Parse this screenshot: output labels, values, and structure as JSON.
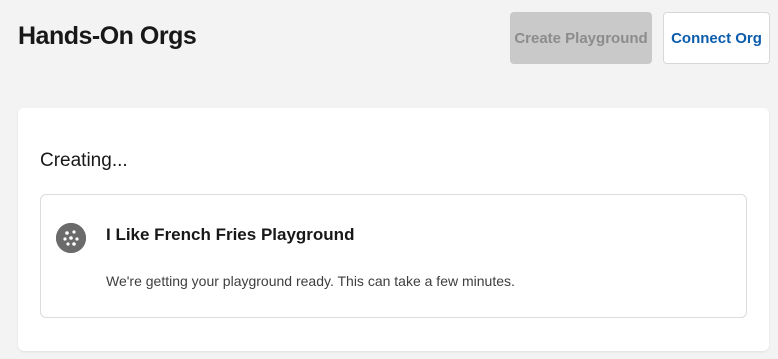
{
  "header": {
    "title": "Hands-On Orgs",
    "create_button_label": "Create Playground",
    "connect_button_label": "Connect Org"
  },
  "creating_section": {
    "heading": "Creating...",
    "org": {
      "name": "I Like French Fries Playground",
      "status_message": "We're getting your playground ready. This can take a few minutes.",
      "icon": "cookie-icon"
    }
  },
  "colors": {
    "page_background": "#f3f3f3",
    "card_background": "#ffffff",
    "disabled_button": "#c9c9c9",
    "link_blue": "#0b5cab",
    "icon_gray": "#6b6b6b"
  }
}
